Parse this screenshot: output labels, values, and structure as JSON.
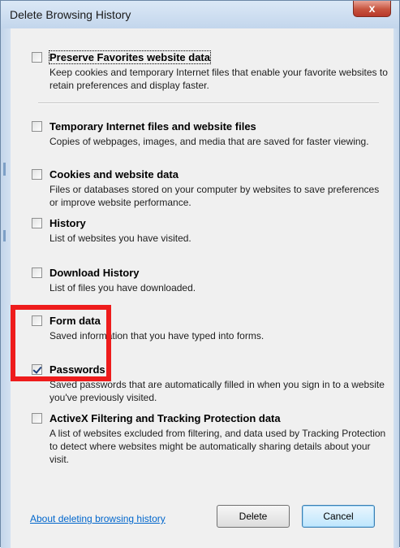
{
  "window": {
    "title": "Delete Browsing History",
    "close_glyph": "x"
  },
  "options": [
    {
      "label": "Preserve Favorites website data",
      "description": "Keep cookies and temporary Internet files that enable your favorite websites to retain preferences and display faster.",
      "checked": false
    },
    {
      "label": "Temporary Internet files and website files",
      "description": "Copies of webpages, images, and media that are saved for faster viewing.",
      "checked": false
    },
    {
      "label": "Cookies and website data",
      "description": "Files or databases stored on your computer by websites to save preferences or improve website performance.",
      "checked": false
    },
    {
      "label": "History",
      "description": "List of websites you have visited.",
      "checked": false
    },
    {
      "label": "Download History",
      "description": "List of files you have downloaded.",
      "checked": false
    },
    {
      "label": "Form data",
      "description": "Saved information that you have typed into forms.",
      "checked": false
    },
    {
      "label": "Passwords",
      "description": "Saved passwords that are automatically filled in when you sign in to a website you've previously visited.",
      "checked": true
    },
    {
      "label": "ActiveX Filtering and Tracking Protection data",
      "description": "A list of websites excluded from filtering, and data used by Tracking Protection to detect where websites might be automatically sharing details about your visit.",
      "checked": false
    }
  ],
  "footer": {
    "about_link": "About deleting browsing history",
    "delete_label": "Delete",
    "cancel_label": "Cancel"
  },
  "colors": {
    "highlight": "#ee1c1c",
    "link": "#0066cc",
    "close_button": "#c7543e"
  }
}
